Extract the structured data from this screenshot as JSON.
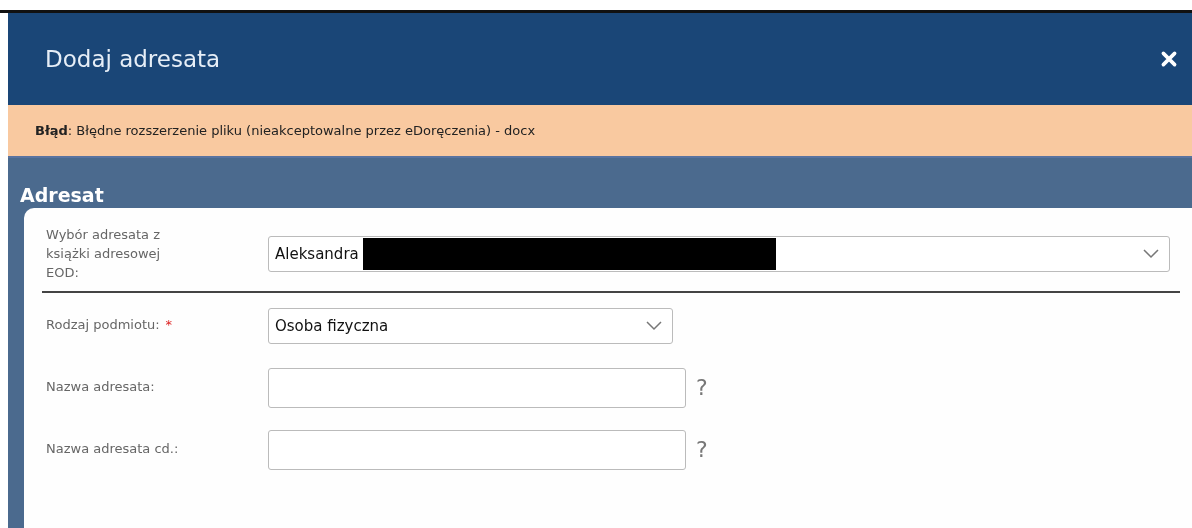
{
  "dialog": {
    "title": "Dodaj adresata",
    "error": "**Błąd**: Błędne rozszerzenie pliku (nieakceptowalne przez eDoręczenia) - docx"
  },
  "section": {
    "title": "Adresat"
  },
  "fields": [
    {
      "kind": "select",
      "label": "Wybór adresata z książki adresowej EOD:",
      "value": "Aleksandra",
      "redacted": true,
      "wide": true,
      "required": false,
      "help": false,
      "divider": true
    },
    {
      "kind": "select",
      "label": "Rodzaj podmiotu:",
      "value": "Osoba fizyczna",
      "redacted": false,
      "wide": false,
      "required": true,
      "required_mark": "*",
      "help": false,
      "divider": false
    },
    {
      "kind": "input",
      "label": "Nazwa adresata:",
      "help": true,
      "help_text": "?",
      "required": false,
      "divider": false
    },
    {
      "kind": "input",
      "label": "Nazwa adresata cd.:",
      "help": true,
      "help_text": "?",
      "required": false,
      "divider": false
    }
  ]
}
